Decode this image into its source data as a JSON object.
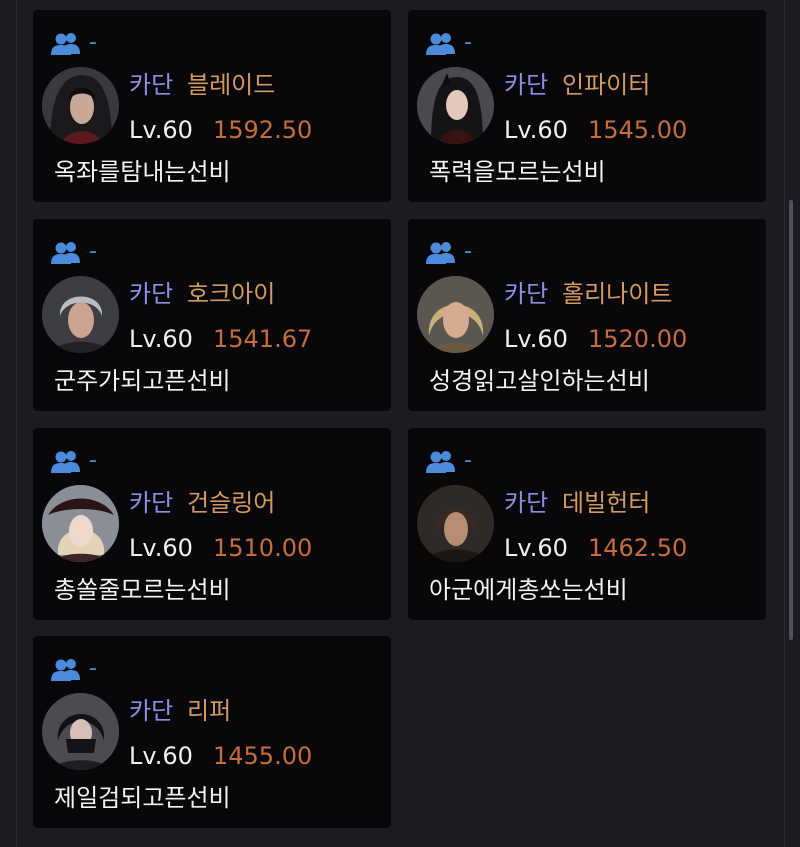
{
  "party_icon": "group-users-icon",
  "colors": {
    "server": "#8c91e3",
    "class": "#d39a5f",
    "item_level": "#c46d3e",
    "party_icon": "#4a8cd9",
    "card_bg": "#08080b",
    "page_bg": "#1c1d23"
  },
  "characters": [
    {
      "party": "-",
      "server": "카단",
      "class": "블레이드",
      "level": "Lv.60",
      "item_level": "1592.50",
      "name": "옥좌를탐내는선비"
    },
    {
      "party": "-",
      "server": "카단",
      "class": "인파이터",
      "level": "Lv.60",
      "item_level": "1545.00",
      "name": "폭력을모르는선비"
    },
    {
      "party": "-",
      "server": "카단",
      "class": "호크아이",
      "level": "Lv.60",
      "item_level": "1541.67",
      "name": "군주가되고픈선비"
    },
    {
      "party": "-",
      "server": "카단",
      "class": "홀리나이트",
      "level": "Lv.60",
      "item_level": "1520.00",
      "name": "성경읽고살인하는선비"
    },
    {
      "party": "-",
      "server": "카단",
      "class": "건슬링어",
      "level": "Lv.60",
      "item_level": "1510.00",
      "name": "총쏠줄모르는선비"
    },
    {
      "party": "-",
      "server": "카단",
      "class": "데빌헌터",
      "level": "Lv.60",
      "item_level": "1462.50",
      "name": "아군에게총쏘는선비"
    },
    {
      "party": "-",
      "server": "카단",
      "class": "리퍼",
      "level": "Lv.60",
      "item_level": "1455.00",
      "name": "제일검되고픈선비"
    }
  ]
}
